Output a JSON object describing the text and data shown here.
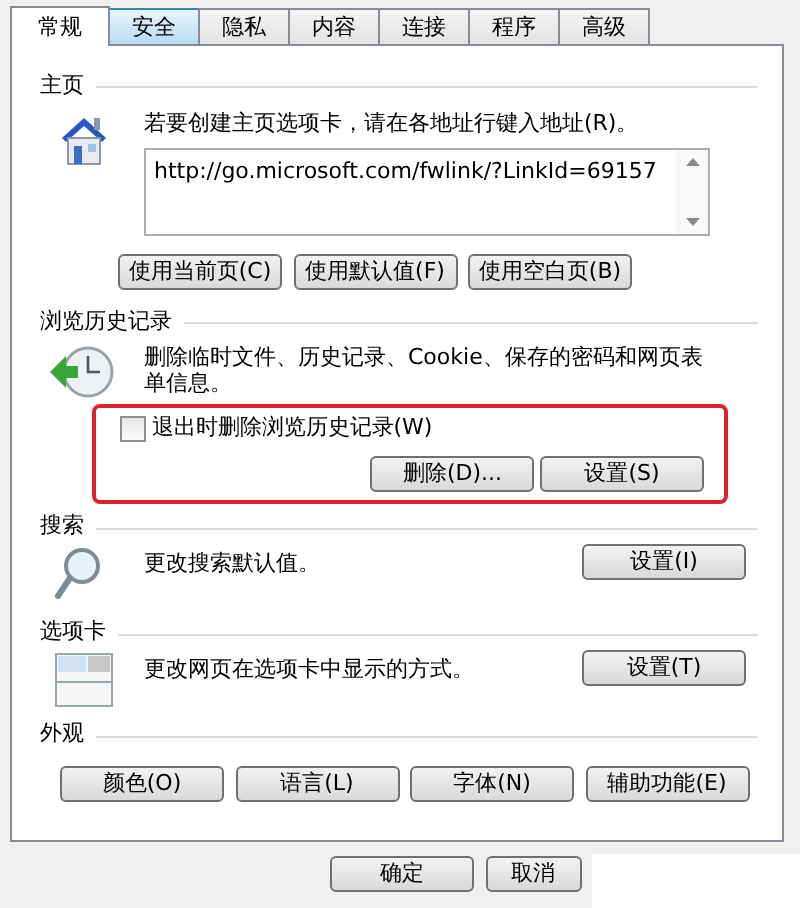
{
  "tabs": [
    {
      "label": "常规",
      "selected": true,
      "hovered": false
    },
    {
      "label": "安全",
      "selected": false,
      "hovered": true
    },
    {
      "label": "隐私",
      "selected": false,
      "hovered": false
    },
    {
      "label": "内容",
      "selected": false,
      "hovered": false
    },
    {
      "label": "连接",
      "selected": false,
      "hovered": false
    },
    {
      "label": "程序",
      "selected": false,
      "hovered": false
    },
    {
      "label": "高级",
      "selected": false,
      "hovered": false
    }
  ],
  "home_page": {
    "heading": "主页",
    "instruction": "若要创建主页选项卡，请在各地址行键入地址(R)。",
    "address": "http://go.microsoft.com/fwlink/?LinkId=69157",
    "buttons": [
      "使用当前页(C)",
      "使用默认值(F)",
      "使用空白页(B)"
    ]
  },
  "browsing_history": {
    "heading": "浏览历史记录",
    "description": "删除临时文件、历史记录、Cookie、保存的密码和网页表单信息。",
    "delete_on_exit": {
      "label": "退出时删除浏览历史记录(W)",
      "checked": false
    },
    "buttons": [
      "删除(D)...",
      "设置(S)"
    ]
  },
  "search": {
    "heading": "搜索",
    "description": "更改搜索默认值。",
    "button": "设置(I)"
  },
  "tabs_section": {
    "heading": "选项卡",
    "description": "更改网页在选项卡中显示的方式。",
    "button": "设置(T)"
  },
  "appearance": {
    "heading": "外观",
    "buttons": [
      "颜色(O)",
      "语言(L)",
      "字体(N)",
      "辅助功能(E)"
    ]
  },
  "dialog_buttons": [
    "确定",
    "取消"
  ]
}
